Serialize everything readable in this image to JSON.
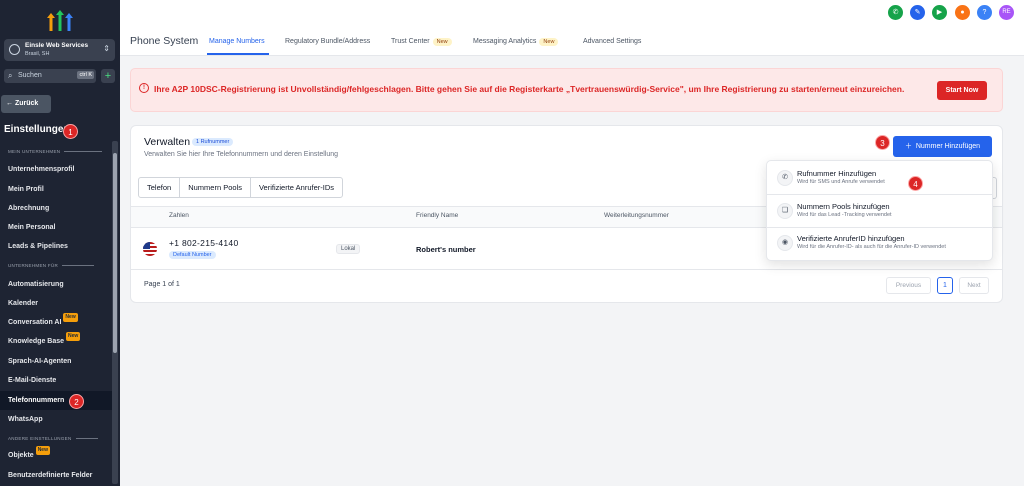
{
  "sidebar": {
    "account_name": "Einsle Web Services",
    "account_location": "Brasil, SH",
    "search_placeholder": "Suchen",
    "search_shortcut": "ctrl K",
    "back_label": "Zurück",
    "settings_title": "Einstellungen",
    "sections": {
      "mein_unternehmen": "MEIN UNTERNEHMEN",
      "unternehmen_fuer": "UNTERNEHMEN    FÜR",
      "andere": "ANDERE EINSTELLUNGEN"
    },
    "items": [
      {
        "label": "Unternehmensprofil"
      },
      {
        "label": "Mein Profil"
      },
      {
        "label": "Abrechnung"
      },
      {
        "label": "Mein Personal"
      },
      {
        "label": "Leads & Pipelines"
      },
      {
        "label": "Automatisierung"
      },
      {
        "label": "Kalender"
      },
      {
        "label": "Conversation AI",
        "badge": "New"
      },
      {
        "label": "Knowledge Base",
        "badge": "New"
      },
      {
        "label": "Sprach-AI-Agenten"
      },
      {
        "label": "E-Mail-Dienste"
      },
      {
        "label": "Telefonnummern"
      },
      {
        "label": "WhatsApp"
      },
      {
        "label": "Objekte",
        "badge": "New"
      },
      {
        "label": "Benutzerdefinierte Felder"
      }
    ]
  },
  "markers": [
    "1",
    "2",
    "3",
    "4"
  ],
  "header": {
    "title": "Phone System",
    "tabs": [
      {
        "label": "Manage Numbers"
      },
      {
        "label": "Regulatory Bundle/Address"
      },
      {
        "label": "Trust Center",
        "badge": "New"
      },
      {
        "label": "Messaging Analytics",
        "badge": "New"
      },
      {
        "label": "Advanced Settings"
      }
    ],
    "avatar_initials": "RE"
  },
  "alert": {
    "message": "Ihre A2P 10DSC-Registrierung ist Unvollständig/fehlgeschlagen. Bitte gehen Sie auf die Registerkarte „Tvertrauenswürdig-Service\", um Ihre Registrierung zu starten/erneut einzureichen.",
    "button": "Start Now"
  },
  "card": {
    "title": "Verwalten",
    "count_badge": "1 Rufnummer",
    "subtitle": "Verwalten Sie hier Ihre Telefonnummern und deren Einstellung",
    "add_button": "Nummer Hinzufügen",
    "segments": [
      "Telefon",
      "Nummern Pools",
      "Verifizierte Anrufer-IDs"
    ],
    "columns": [
      "Zahlen",
      "Friendly Name",
      "Weiterleitungsnummer"
    ],
    "row": {
      "number": "+1 802-215-4140",
      "default_badge": "Default Number",
      "type": "Lokal",
      "friendly_name": "Robert's number"
    },
    "page_info": "Page 1 of 1",
    "previous": "Previous",
    "page": "1",
    "next": "Next"
  },
  "dropdown": [
    {
      "title": "Rufnummer Hinzufügen",
      "sub": "Wird für SMS und Anrufe verwendet"
    },
    {
      "title": "Nummern Pools hinzufügen",
      "sub": "Wird für das Lead -Tracking verwendet"
    },
    {
      "title": "Verifizierte AnruferID hinzufügen",
      "sub": "Wird für die Anrufer-ID- als auch für die Anrufer-ID verwendet"
    }
  ],
  "colors": {
    "sidebar_bg": "#1e2433",
    "primary": "#2563eb",
    "danger": "#dc2626",
    "badge_new": "#f59e0b"
  }
}
